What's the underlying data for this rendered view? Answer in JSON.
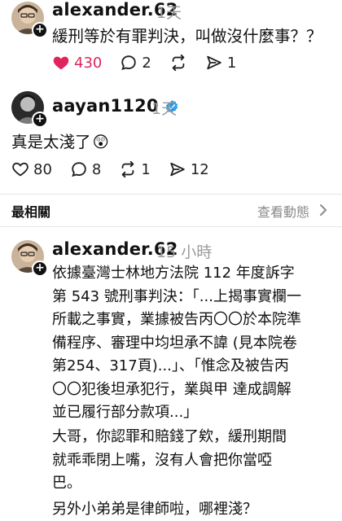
{
  "post1": {
    "username": "alexander.62",
    "time": "1天",
    "text": "緩刑等於有罪判決，叫做沒什麼事？？",
    "likes": "430",
    "replies": "2",
    "reposts": "",
    "shares": "1",
    "like_color": "#e0245e"
  },
  "post2": {
    "username": "aayan1120",
    "time": "1天",
    "text": "真是太淺了",
    "emoji": "😲",
    "likes": "80",
    "replies": "8",
    "reposts": "1",
    "shares": "12"
  },
  "section": {
    "sort_label": "最相關",
    "view_activity": "查看動態"
  },
  "post3": {
    "username": "alexander.62",
    "time": "15 小時",
    "para1": [
      "依據臺灣士林地方法院 112 年度訴字",
      "第 543 號刑事判決：「...上揭事實欄一",
      "所載之事實，業據被告丙〇〇於本院準",
      "備程序、審理中均坦承不諱 (見本院卷",
      "第254、317頁)...」、「惟念及被告丙",
      "〇〇犯後坦承犯行，業與甲 達成調解",
      "並已履行部分款項...」"
    ],
    "para2": [
      "大哥，你認罪和賠錢了欸，緩刑期間",
      "就乖乖閉上嘴，沒有人會把你當啞",
      "巴。"
    ],
    "para3": "另外小弟弟是律師啦，哪裡淺？"
  },
  "icons": {
    "like": "heart-icon",
    "reply": "comment-bubble-icon",
    "repost": "repost-arrows-icon",
    "share": "send-icon",
    "verified": "verified-badge-icon",
    "follow": "plus-icon",
    "chevron": "chevron-right-icon"
  }
}
